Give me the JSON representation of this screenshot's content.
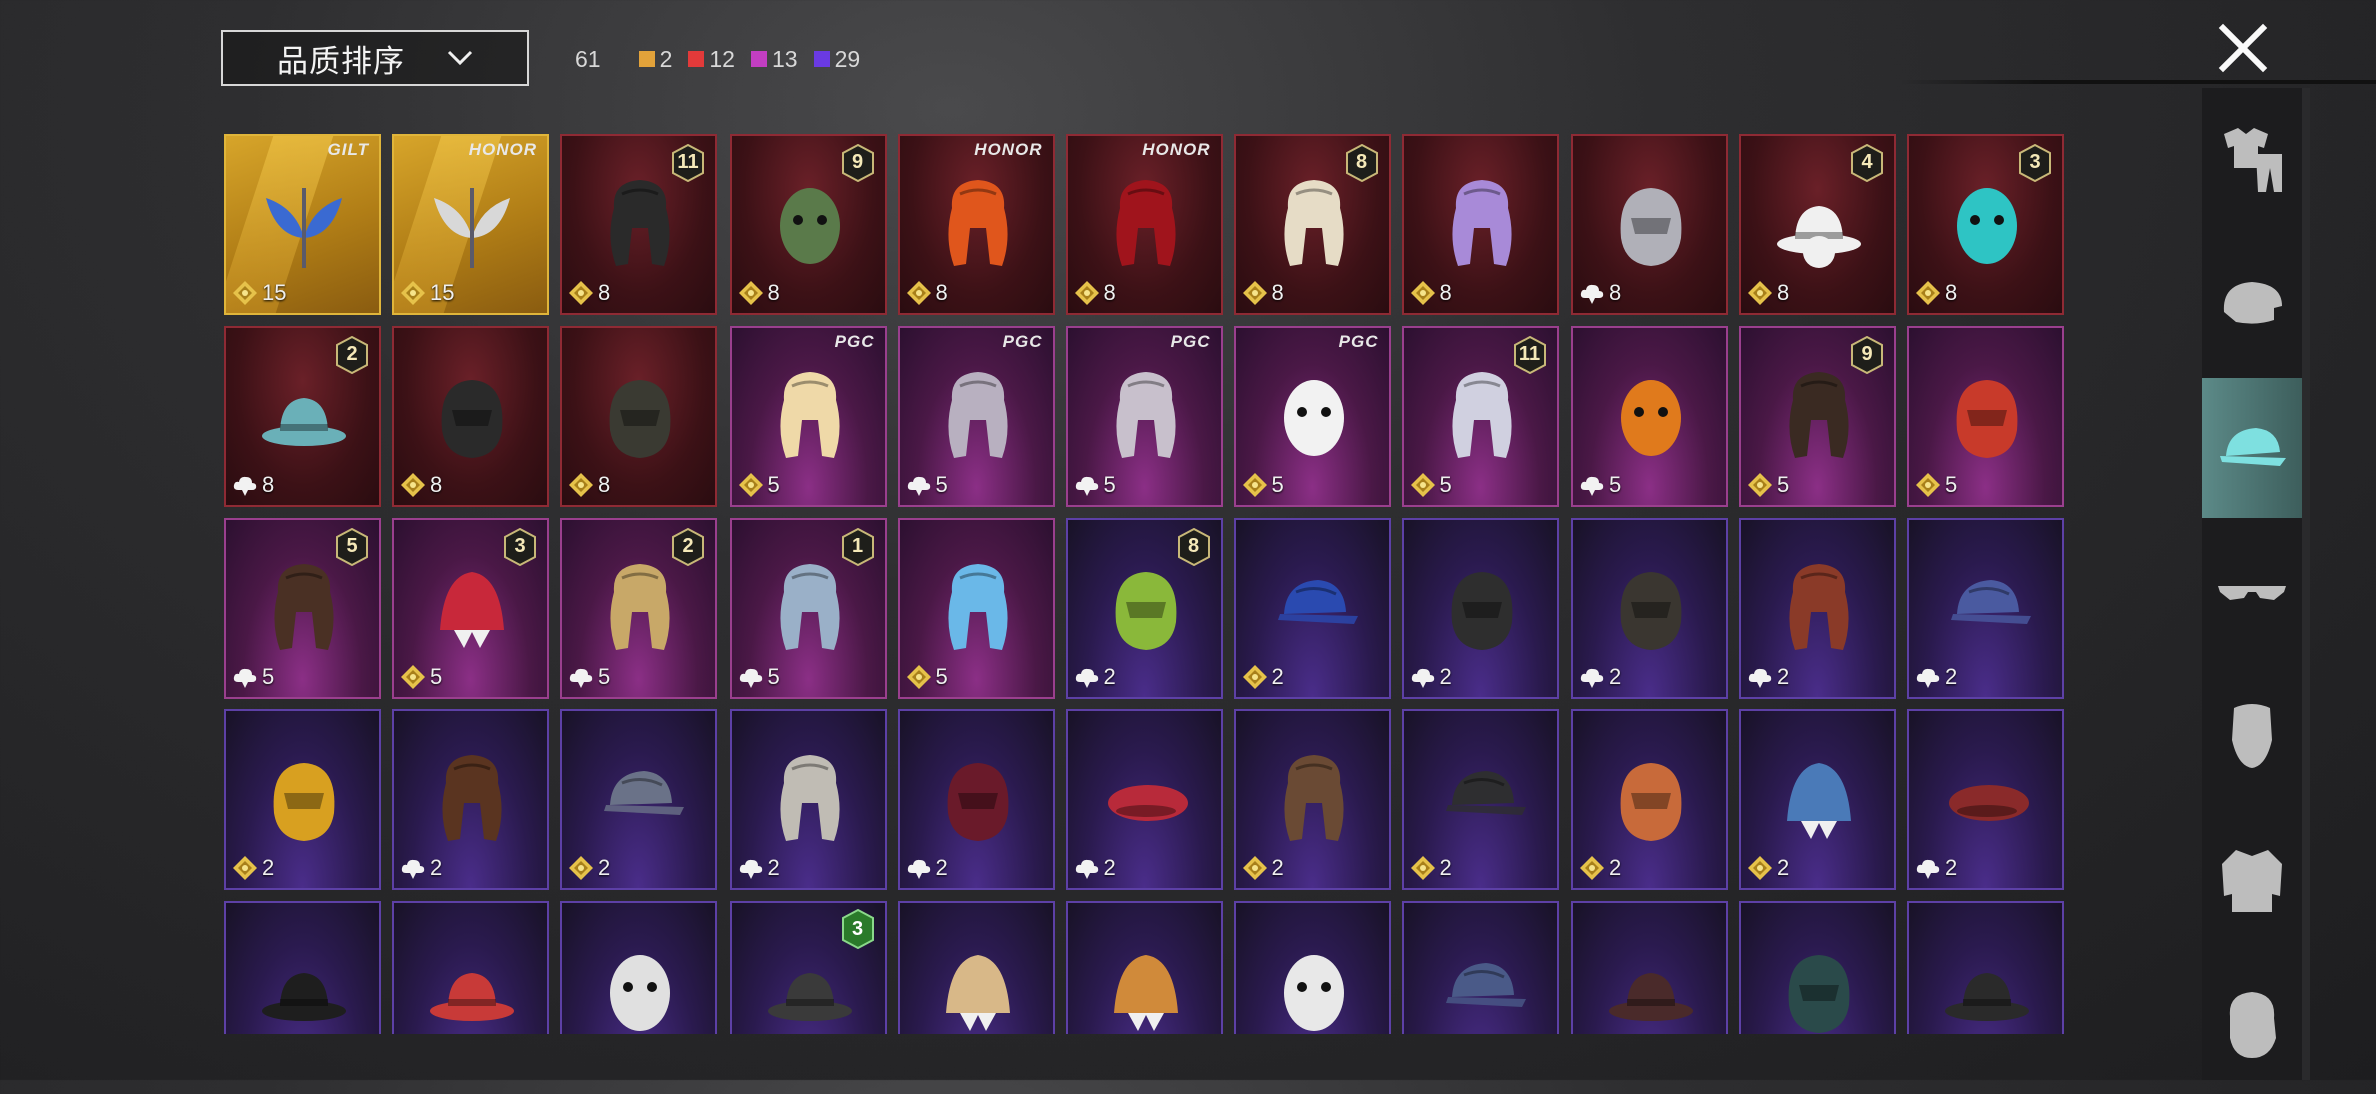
{
  "header": {
    "sort_label": "品质排序",
    "total_count": "61",
    "quality_counts": [
      {
        "label": "2",
        "color": "#e2a23a"
      },
      {
        "label": "12",
        "color": "#e23a3a"
      },
      {
        "label": "13",
        "color": "#c23ec2"
      },
      {
        "label": "29",
        "color": "#6a3ae2"
      }
    ],
    "close_icon": "close-icon"
  },
  "categories": [
    {
      "name": "outfit",
      "icon": "shirt-pants-icon",
      "active": false
    },
    {
      "name": "helmet",
      "icon": "helmet-icon",
      "active": false
    },
    {
      "name": "hat",
      "icon": "cap-icon",
      "active": true
    },
    {
      "name": "glasses",
      "icon": "glasses-icon",
      "active": false
    },
    {
      "name": "mask",
      "icon": "face-mask-icon",
      "active": false
    },
    {
      "name": "jacket",
      "icon": "jacket-icon",
      "active": false
    },
    {
      "name": "head",
      "icon": "head-icon",
      "active": false
    }
  ],
  "items": [
    {
      "rarity": "gold",
      "currency": "gem",
      "cost": "15",
      "tag": "GILT",
      "icon": "staff-wings-icon",
      "color": "#3a6ad2"
    },
    {
      "rarity": "gold",
      "currency": "gem",
      "cost": "15",
      "tag": "HONOR",
      "icon": "wings-crown-icon",
      "color": "#d8d8d8"
    },
    {
      "rarity": "red",
      "currency": "gem",
      "cost": "8",
      "badge": "11",
      "icon": "dark-hair-icon",
      "color": "#2a2a2a"
    },
    {
      "rarity": "red",
      "currency": "gem",
      "cost": "8",
      "badge": "9",
      "icon": "zombie-head-icon",
      "color": "#5a7a4a"
    },
    {
      "rarity": "red",
      "currency": "gem",
      "cost": "8",
      "tag": "HONOR",
      "icon": "orange-hair-icon",
      "color": "#e0561c"
    },
    {
      "rarity": "red",
      "currency": "gem",
      "cost": "8",
      "tag": "HONOR",
      "icon": "red-hair-icon",
      "color": "#a0141c"
    },
    {
      "rarity": "red",
      "currency": "gem",
      "cost": "8",
      "badge": "8",
      "icon": "blonde-hair-icon",
      "color": "#e6dcc6"
    },
    {
      "rarity": "red",
      "currency": "gem",
      "cost": "8",
      "icon": "purple-hair-icon",
      "color": "#a88ad8"
    },
    {
      "rarity": "red",
      "currency": "cloud",
      "cost": "8",
      "icon": "demon-mask-icon",
      "color": "#b0b0b8"
    },
    {
      "rarity": "red",
      "currency": "gem",
      "cost": "8",
      "badge": "4",
      "icon": "tophat-snowman-icon",
      "color": "#f0f0f0"
    },
    {
      "rarity": "red",
      "currency": "gem",
      "cost": "8",
      "badge": "3",
      "icon": "joker-head-icon",
      "color": "#2ec4c4"
    },
    {
      "rarity": "red",
      "currency": "cloud",
      "cost": "8",
      "badge": "2",
      "icon": "teal-bucket-hat-icon",
      "color": "#6ab0b8"
    },
    {
      "rarity": "red",
      "currency": "gem",
      "cost": "8",
      "icon": "dark-armor-hood-icon",
      "color": "#2a2a2a"
    },
    {
      "rarity": "red",
      "currency": "gem",
      "cost": "8",
      "icon": "horned-helmet-icon",
      "color": "#3a3a32"
    },
    {
      "rarity": "pink",
      "currency": "gem",
      "cost": "5",
      "tag": "PGC",
      "icon": "blonde-bob-icon",
      "color": "#efd9a8"
    },
    {
      "rarity": "pink",
      "currency": "cloud",
      "cost": "5",
      "tag": "PGC",
      "icon": "grey-spiky-hair-icon",
      "color": "#b8b0c0"
    },
    {
      "rarity": "pink",
      "currency": "cloud",
      "cost": "5",
      "tag": "PGC",
      "icon": "long-grey-hair-icon",
      "color": "#c8c0cc"
    },
    {
      "rarity": "pink",
      "currency": "gem",
      "cost": "5",
      "tag": "PGC",
      "icon": "panda-head-icon",
      "color": "#f2f2f2"
    },
    {
      "rarity": "pink",
      "currency": "gem",
      "cost": "5",
      "badge": "11",
      "icon": "flower-wreath-hair-icon",
      "color": "#d0d0e0"
    },
    {
      "rarity": "pink",
      "currency": "cloud",
      "cost": "5",
      "icon": "pumpkin-head-icon",
      "color": "#e07a1c"
    },
    {
      "rarity": "pink",
      "currency": "gem",
      "cost": "5",
      "badge": "9",
      "icon": "brown-ponytail-icon",
      "color": "#3a2a22"
    },
    {
      "rarity": "pink",
      "currency": "gem",
      "cost": "5",
      "icon": "cat-mask-helmet-icon",
      "color": "#c83a2a"
    },
    {
      "rarity": "pink",
      "currency": "cloud",
      "cost": "5",
      "badge": "5",
      "icon": "pigtails-hair-icon",
      "color": "#4a3024"
    },
    {
      "rarity": "pink",
      "currency": "gem",
      "cost": "5",
      "badge": "3",
      "icon": "jester-hat-icon",
      "color": "#c8283a"
    },
    {
      "rarity": "pink",
      "currency": "cloud",
      "cost": "5",
      "badge": "2",
      "icon": "grey-beanie-hair-icon",
      "color": "#c8a868"
    },
    {
      "rarity": "pink",
      "currency": "cloud",
      "cost": "5",
      "badge": "1",
      "icon": "space-buns-hair-icon",
      "color": "#9ab0c8"
    },
    {
      "rarity": "pink",
      "currency": "gem",
      "cost": "5",
      "icon": "alien-antenna-icon",
      "color": "#6ab8e8"
    },
    {
      "rarity": "purple",
      "currency": "cloud",
      "cost": "2",
      "badge": "8",
      "icon": "green-skull-hood-icon",
      "color": "#8ab83a"
    },
    {
      "rarity": "purple",
      "currency": "gem",
      "cost": "2",
      "icon": "baseball-cap-icon",
      "color": "#2a4ab0"
    },
    {
      "rarity": "purple",
      "currency": "cloud",
      "cost": "2",
      "icon": "gas-mask-helmet-icon",
      "color": "#2e2e2e"
    },
    {
      "rarity": "purple",
      "currency": "cloud",
      "cost": "2",
      "icon": "riot-helmet-icon",
      "color": "#3a3630"
    },
    {
      "rarity": "purple",
      "currency": "cloud",
      "cost": "2",
      "icon": "aviator-goggles-hair-icon",
      "color": "#8a3a28"
    },
    {
      "rarity": "purple",
      "currency": "cloud",
      "cost": "2",
      "icon": "dotted-cap-icon",
      "color": "#4a5aa0"
    },
    {
      "rarity": "purple",
      "currency": "gem",
      "cost": "2",
      "icon": "ninja-ponytail-helmet-icon",
      "color": "#d8a020"
    },
    {
      "rarity": "purple",
      "currency": "cloud",
      "cost": "2",
      "icon": "brown-bob-hair-icon",
      "color": "#5a3420"
    },
    {
      "rarity": "purple",
      "currency": "gem",
      "cost": "2",
      "icon": "grey-cap-icon",
      "color": "#6a7288"
    },
    {
      "rarity": "purple",
      "currency": "cloud",
      "cost": "2",
      "icon": "turban-icon",
      "color": "#c0bcb4"
    },
    {
      "rarity": "purple",
      "currency": "cloud",
      "cost": "2",
      "icon": "moto-helmet-icon",
      "color": "#6a1a2a"
    },
    {
      "rarity": "purple",
      "currency": "cloud",
      "cost": "2",
      "icon": "red-beret-icon",
      "color": "#b82a3a"
    },
    {
      "rarity": "purple",
      "currency": "gem",
      "cost": "2",
      "icon": "pilot-cap-goggles-icon",
      "color": "#6a4a34"
    },
    {
      "rarity": "purple",
      "currency": "gem",
      "cost": "2",
      "icon": "black-cap-icon",
      "color": "#2e2e30"
    },
    {
      "rarity": "purple",
      "currency": "gem",
      "cost": "2",
      "icon": "football-helmet-icon",
      "color": "#c86a3a"
    },
    {
      "rarity": "purple",
      "currency": "gem",
      "cost": "2",
      "icon": "shark-hat-icon",
      "color": "#4a7ab8"
    },
    {
      "rarity": "purple",
      "currency": "cloud",
      "cost": "2",
      "icon": "maroon-beret-icon",
      "color": "#8a2a2a"
    },
    {
      "rarity": "purple",
      "currency": "gem",
      "cost": "",
      "icon": "black-fedora-icon",
      "color": "#1e1e1e"
    },
    {
      "rarity": "purple",
      "currency": "gem",
      "cost": "",
      "icon": "red-fedora-icon",
      "color": "#c83a38"
    },
    {
      "rarity": "purple",
      "currency": "gem",
      "cost": "",
      "icon": "white-shark-head-icon",
      "color": "#e0e0e0"
    },
    {
      "rarity": "purple",
      "currency": "gem",
      "cost": "",
      "green_badge": "3",
      "icon": "grey-fedora-icon",
      "color": "#3a3a3a"
    },
    {
      "rarity": "purple",
      "currency": "gem",
      "cost": "",
      "icon": "ice-cream-hat-icon",
      "color": "#d8b888"
    },
    {
      "rarity": "purple",
      "currency": "gem",
      "cost": "",
      "icon": "burger-hat-icon",
      "color": "#d08a3a"
    },
    {
      "rarity": "purple",
      "currency": "gem",
      "cost": "",
      "icon": "head-mirror-icon",
      "color": "#e8e8e8"
    },
    {
      "rarity": "purple",
      "currency": "gem",
      "cost": "",
      "icon": "navy-cap-icon",
      "color": "#4a5a88"
    },
    {
      "rarity": "purple",
      "currency": "gem",
      "cost": "",
      "icon": "brown-fedora-icon",
      "color": "#4a2a2a"
    },
    {
      "rarity": "purple",
      "currency": "gem",
      "cost": "",
      "icon": "netted-helmet-icon",
      "color": "#2a4a4a"
    },
    {
      "rarity": "purple",
      "currency": "gem",
      "cost": "",
      "icon": "bucket-hat-icon",
      "color": "#2a2a2a"
    }
  ]
}
